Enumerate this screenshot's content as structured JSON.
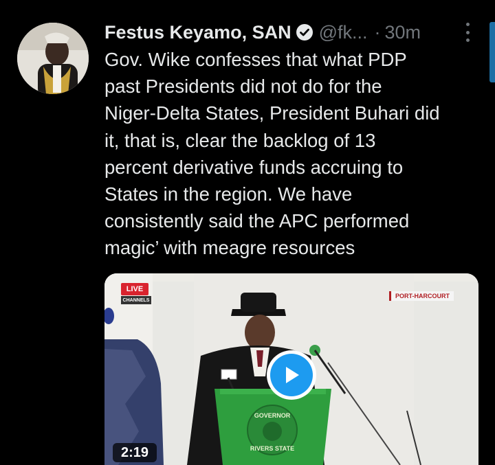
{
  "tweet": {
    "author_name": "Festus Keyamo, SAN",
    "handle": "@fk...",
    "separator": "·",
    "time": "30m",
    "text_lines": [
      "Gov. Wike confesses that what PDP",
      "past Presidents did not do for the",
      "Niger-Delta States, President Buhari did",
      "it, that is, clear the backlog of 13",
      "percent derivative funds accruing to",
      "States in the region. We have",
      "consistently said the APC performed",
      "magic’ with meagre resources"
    ]
  },
  "video": {
    "live_badge": "LIVE",
    "channels_badge": "CHANNELS",
    "location_tag": "PORT-HARCOURT",
    "duration": "2:19",
    "podium_text": "GOVERNOR RIVERS STATE"
  },
  "icons": {
    "verified": "verified-badge-icon",
    "more": "more-options-icon",
    "play": "play-icon"
  },
  "colors": {
    "background": "#000000",
    "primary_text": "#e7e9ea",
    "secondary_text": "#71767b",
    "accent_blue": "#1d9bf0"
  }
}
